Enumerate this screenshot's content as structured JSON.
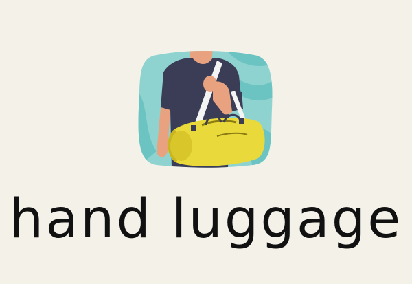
{
  "flashcard": {
    "word": "hand luggage",
    "illustration_icon": "person-carrying-duffel-bag-icon"
  },
  "colors": {
    "background": "#f3f1e8",
    "card_teal": "#8fd3d1",
    "card_wave": "#6cc4c2",
    "shirt": "#3b3d57",
    "skin": "#e9a27f",
    "bag_yellow": "#e9d93a",
    "bag_shadow": "#c9b520",
    "text": "#111111"
  }
}
